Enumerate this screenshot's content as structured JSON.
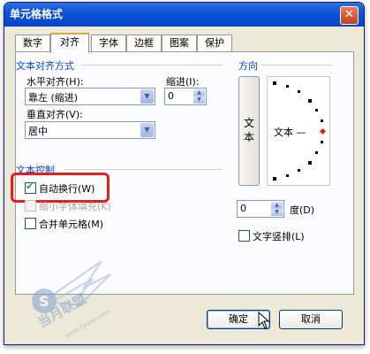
{
  "dialog": {
    "title": "单元格格式",
    "close_glyph": "✕"
  },
  "tabs": [
    {
      "label": "数字",
      "active": false
    },
    {
      "label": "对齐",
      "active": true
    },
    {
      "label": "字体",
      "active": false
    },
    {
      "label": "边框",
      "active": false
    },
    {
      "label": "图案",
      "active": false
    },
    {
      "label": "保护",
      "active": false
    }
  ],
  "text_alignment": {
    "group_title": "文本对齐方式",
    "horizontal_label": "水平对齐(H):",
    "horizontal_value": "靠左 (缩进)",
    "vertical_label": "垂直对齐(V):",
    "vertical_value": "居中",
    "indent_label": "缩进(I):",
    "indent_value": "0"
  },
  "text_control": {
    "group_title": "文本控制",
    "wrap_text": {
      "label": "自动换行(W)",
      "checked": true
    },
    "shrink_to_fit": {
      "label": "缩小字体填充(K)",
      "checked": false,
      "disabled": true
    },
    "merge_cells": {
      "label": "合并单元格(M)",
      "checked": false
    }
  },
  "orientation": {
    "group_title": "方向",
    "vertical_text_button": "文本",
    "preview_text": "文本 —",
    "degrees_value": "0",
    "degrees_label": "度(D)",
    "vertical_checkbox": {
      "label": "文字竖排(L)",
      "checked": false
    }
  },
  "buttons": {
    "ok": "确定",
    "cancel": "取消"
  },
  "watermark": {
    "text": "当月联盟",
    "url": "www.dyuee.com"
  },
  "colors": {
    "titlebar": "#0a52d6",
    "group_title": "#0046d5",
    "highlight": "#e02020"
  }
}
